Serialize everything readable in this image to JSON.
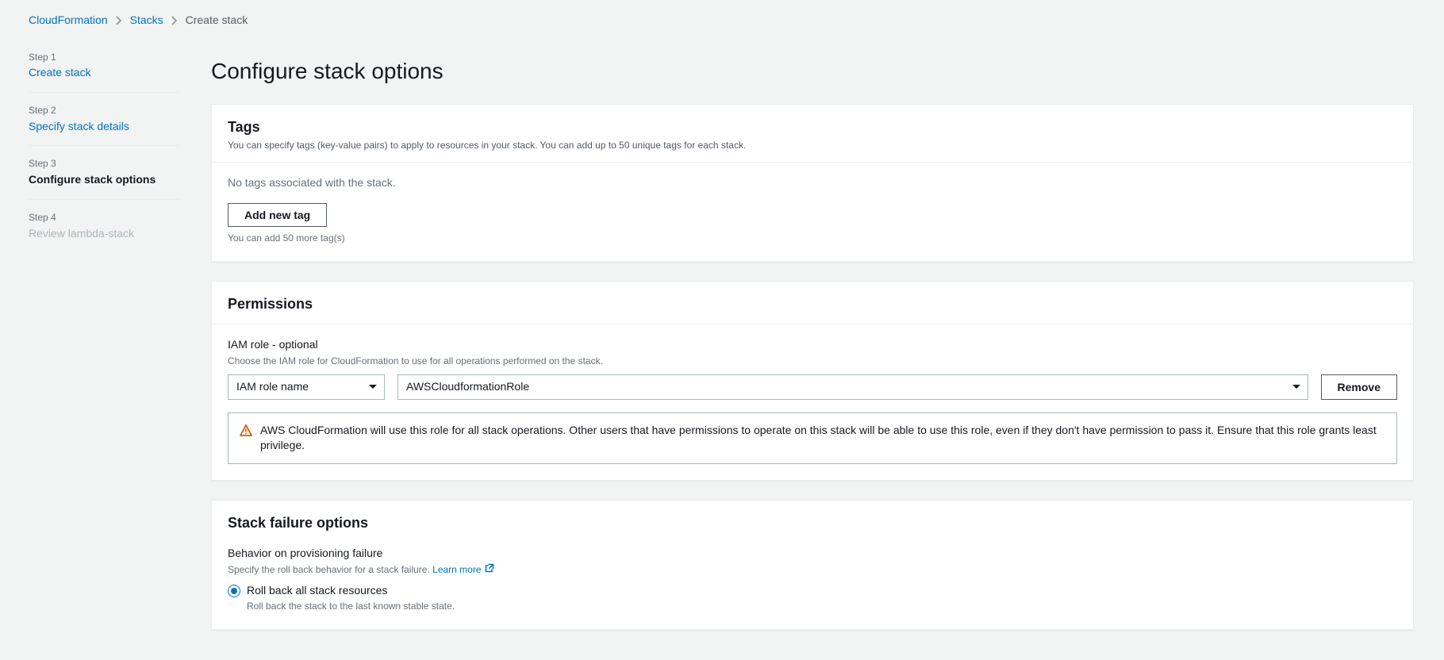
{
  "breadcrumb": {
    "root": "CloudFormation",
    "second": "Stacks",
    "current": "Create stack"
  },
  "wizard": {
    "step1_num": "Step 1",
    "step1_title": "Create stack",
    "step2_num": "Step 2",
    "step2_title": "Specify stack details",
    "step3_num": "Step 3",
    "step3_title": "Configure stack options",
    "step4_num": "Step 4",
    "step4_title": "Review lambda-stack"
  },
  "page_title": "Configure stack options",
  "tags": {
    "heading": "Tags",
    "desc": "You can specify tags (key-value pairs) to apply to resources in your stack. You can add up to 50 unique tags for each stack.",
    "empty": "No tags associated with the stack.",
    "add_btn": "Add new tag",
    "limit": "You can add 50 more tag(s)"
  },
  "permissions": {
    "heading": "Permissions",
    "iam_label": "IAM role - optional",
    "iam_hint": "Choose the IAM role for CloudFormation to use for all operations performed on the stack.",
    "role_type": "IAM role name",
    "role_value": "AWSCloudformationRole",
    "remove": "Remove",
    "warning": "AWS CloudFormation will use this role for all stack operations. Other users that have permissions to operate on this stack will be able to use this role, even if they don't have permission to pass it. Ensure that this role grants least privilege."
  },
  "failure": {
    "heading": "Stack failure options",
    "behavior_label": "Behavior on provisioning failure",
    "behavior_hint": "Specify the roll back behavior for a stack failure.",
    "learn_more": "Learn more",
    "option1_title": "Roll back all stack resources",
    "option1_sub": "Roll back the stack to the last known stable state."
  }
}
